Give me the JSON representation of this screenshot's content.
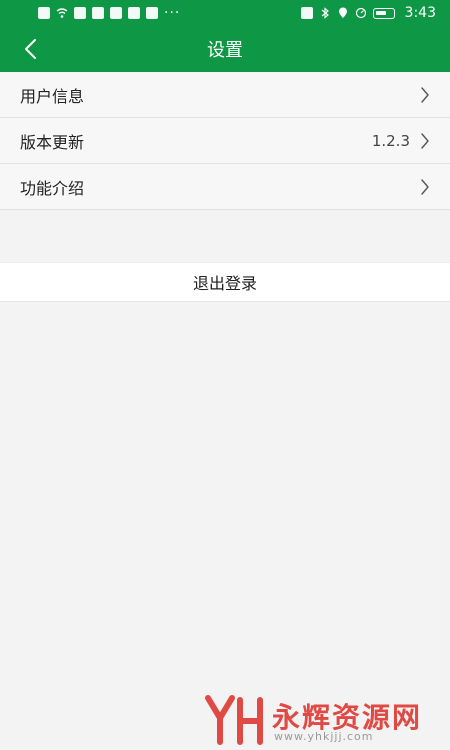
{
  "status_bar": {
    "time": "3:43",
    "left_icons": [
      "alert-icon",
      "wifi-icon",
      "app-icon",
      "location-icon",
      "book-icon",
      "share-icon",
      "eye-icon"
    ],
    "right_icons": [
      "nfc-icon",
      "bluetooth-icon",
      "location-icon",
      "speed-icon",
      "battery-icon"
    ],
    "overflow": "···"
  },
  "header": {
    "title": "设置",
    "back_icon": "chevron-left-icon",
    "color": "#0e9744"
  },
  "settings": {
    "items": [
      {
        "label": "用户信息",
        "value": ""
      },
      {
        "label": "版本更新",
        "value": "1.2.3"
      },
      {
        "label": "功能介绍",
        "value": ""
      }
    ]
  },
  "logout": {
    "label": "退出登录"
  },
  "watermark": {
    "name": "永辉资源网",
    "url": "www.yhkjjj.com"
  }
}
